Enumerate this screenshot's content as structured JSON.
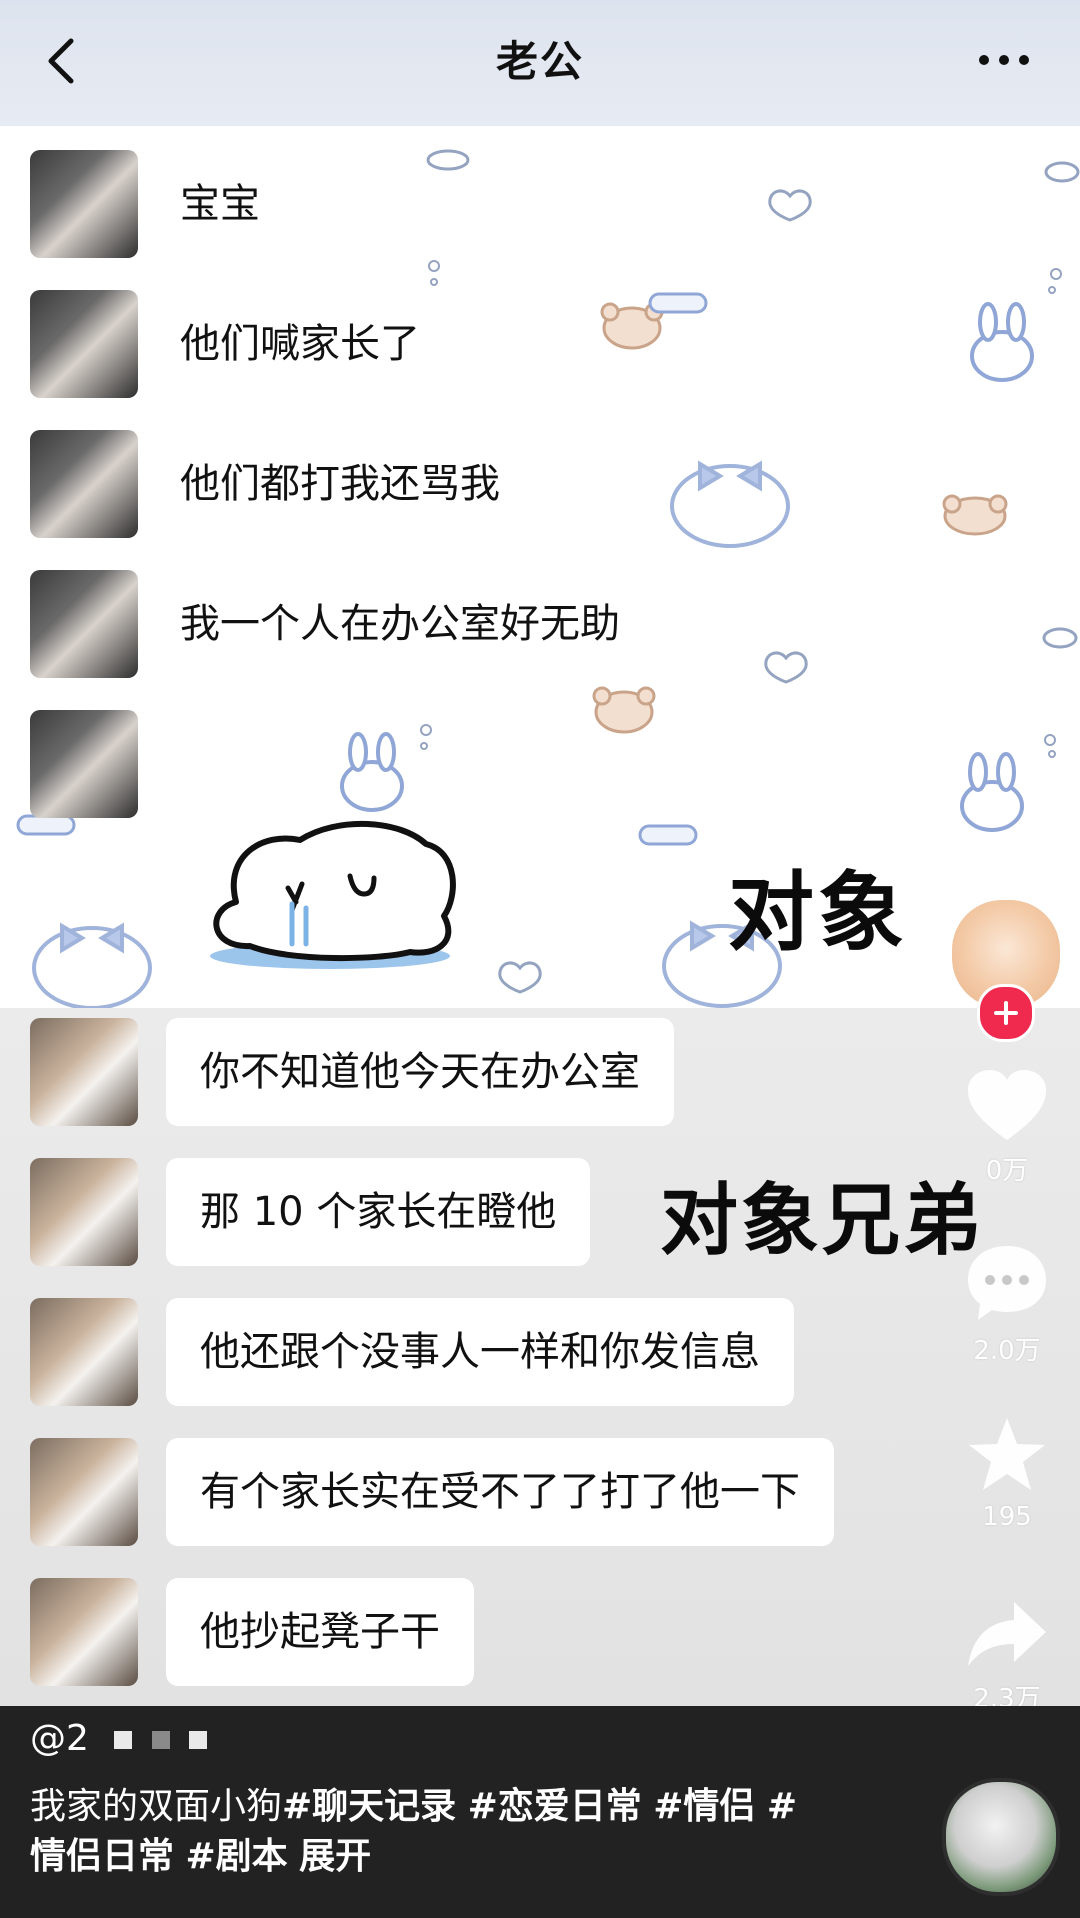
{
  "header": {
    "title": "老公"
  },
  "chat_top": {
    "messages": [
      {
        "text": "宝宝"
      },
      {
        "text": "他们喊家长了"
      },
      {
        "text": "他们都打我还骂我"
      },
      {
        "text": "我一个人在办公室好无助"
      },
      {
        "text": ""
      }
    ],
    "overlay_label": "对象"
  },
  "chat_bottom": {
    "messages": [
      {
        "text": "你不知道他今天在办公室"
      },
      {
        "text": "那 10 个家长在瞪他"
      },
      {
        "text": "他还跟个没事人一样和你发信息"
      },
      {
        "text": "有个家长实在受不了了打了他一下"
      },
      {
        "text": "他抄起凳子干"
      }
    ],
    "overlay_label": "对象兄弟"
  },
  "rail": {
    "likes": "0万",
    "comments": "2.0万",
    "favorites": "195",
    "shares": "2.3万"
  },
  "bottom_info": {
    "handle": "@2",
    "caption_text": "我家的双面小狗",
    "tags": [
      "#聊天记录",
      "#恋爱日常",
      "#情侣",
      "#情侣日常",
      "#剧本"
    ],
    "expand_label": "展开"
  }
}
